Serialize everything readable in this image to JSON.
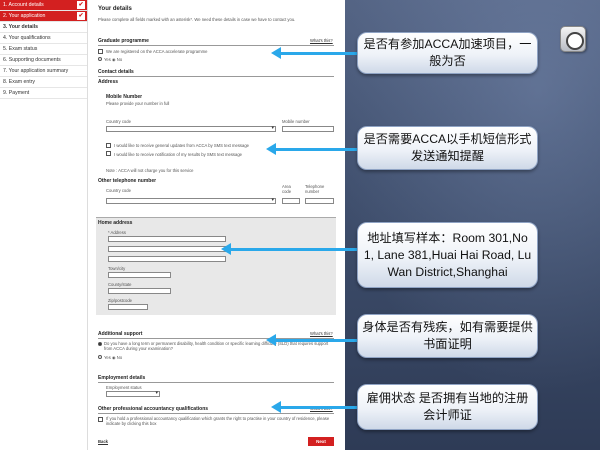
{
  "nav": {
    "items": [
      {
        "label": "1. Account details",
        "state": "done"
      },
      {
        "label": "2. Your application",
        "state": "done"
      },
      {
        "label": "3. Your details",
        "state": "current"
      },
      {
        "label": "4. Your qualifications",
        "state": ""
      },
      {
        "label": "5. Exam status",
        "state": ""
      },
      {
        "label": "6. Supporting documents",
        "state": ""
      },
      {
        "label": "7. Your application summary",
        "state": ""
      },
      {
        "label": "8. Exam entry",
        "state": ""
      },
      {
        "label": "9. Payment",
        "state": ""
      }
    ]
  },
  "form": {
    "title": "Your details",
    "intro": "Please complete all fields marked with an asterisk*. We need these details in case we have to contact you.",
    "whats_this": "What's this?",
    "grad_title": "Graduate programme",
    "grad_opt1": "We are registered on the ACCA accelerate programme",
    "grad_opt2": "Yes ◉ No",
    "contact_title": "Contact details",
    "address_label": "Address",
    "mobile_title": "Mobile Number",
    "mobile_hint": "Please provide your number in full",
    "country_code": "Country code",
    "mobile_number": "Mobile number",
    "sms1": "I would like to receive general updates from ACCA by SMS text message",
    "sms2": "I would like to receive notification of my results by SMS text message",
    "note": "Note : ACCA will not charge you for this service",
    "other_phone": "Other telephone number",
    "area_code": "Area code",
    "telephone": "Telephone number",
    "home_title": "Home address",
    "town": "Town/city",
    "county": "County/state",
    "zip": "Zip/postcode",
    "add_support_title": "Additional support",
    "add_support_q": "Do you have a long term or permanent disability, health condition or specific learning difficulty (SLD) that requires support from ACCA during your examination?",
    "yes_no": "Yes ◉ No",
    "emp_title": "Employment details",
    "emp_status": "Employment status",
    "opa_title": "Other professional accountancy qualifications",
    "opa_q": "If you hold a professional accountancy qualification which grants the right to practise in your country of residence, please indicate by clicking this box",
    "back": "Back",
    "next": "Next"
  },
  "callouts": {
    "c1": "是否有参加ACCA加速项目，一般为否",
    "c2": "是否需要ACCA以手机短信形式发送通知提醒",
    "c3": "地址填写样本：Room 301,No 1, Lane 381,Huai Hai Road, Lu Wan District,Shanghai",
    "c4": "身体是否有残疾，如有需要提供书面证明",
    "c5": "雇佣状态 是否拥有当地的注册会计师证"
  },
  "colors": {
    "accent": "#d32020",
    "arrow": "#2aa8ea"
  }
}
